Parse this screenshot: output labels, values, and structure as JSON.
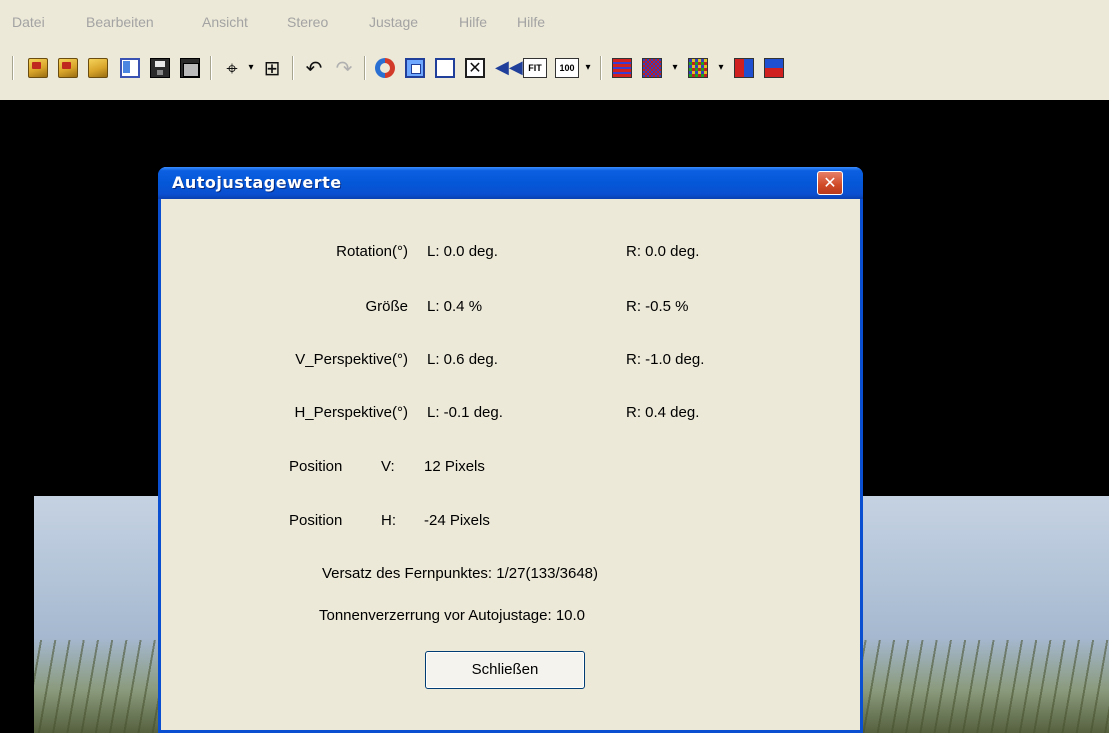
{
  "menubar": {
    "items": [
      "Datei",
      "Bearbeiten",
      "Ansicht",
      "Stereo",
      "Justage",
      "Hilfe",
      "Hilfe"
    ]
  },
  "toolbar": {
    "labels": {
      "fit": "FIT",
      "hundred": "100"
    },
    "icons": [
      "open-folder-icon",
      "open-folder-icon",
      "open-folder-icon",
      "window-icon",
      "save-icon",
      "save-all-icon",
      "crop-icon",
      "chevron-down-icon",
      "move-icon",
      "undo-icon",
      "redo-icon",
      "swap-icon",
      "frame-icon",
      "frame-empty-icon",
      "frame-x-icon",
      "arrows-icon",
      "fit-icon",
      "zoom-100-icon",
      "chevron-down-icon",
      "stripes-icon",
      "checker-icon",
      "chevron-down-icon",
      "checker-color-icon",
      "chevron-down-icon",
      "split-vertical-icon",
      "split-horizontal-icon"
    ]
  },
  "dialog": {
    "title": "Autojustagewerte",
    "close_glyph": "✕",
    "rows": [
      {
        "label": "Rotation(°)",
        "left": "L: 0.0 deg.",
        "right": "R: 0.0 deg."
      },
      {
        "label": "Größe",
        "left": "L: 0.4 %",
        "right": "R: -0.5 %"
      },
      {
        "label": "V_Perspektive(°)",
        "left": "L: 0.6 deg.",
        "right": "R: -1.0 deg."
      },
      {
        "label": "H_Perspektive(°)",
        "left": "L: -0.1 deg.",
        "right": "R: 0.4 deg."
      }
    ],
    "position_v": {
      "label": "Position",
      "axis": "V:",
      "value": "12 Pixels"
    },
    "position_h": {
      "label": "Position",
      "axis": "H:",
      "value": "-24 Pixels"
    },
    "versatz": "Versatz des Fernpunktes: 1/27(133/3648)",
    "tonnen": "Tonnenverzerrung vor Autojustage: 10.0",
    "close_button": "Schließen"
  }
}
